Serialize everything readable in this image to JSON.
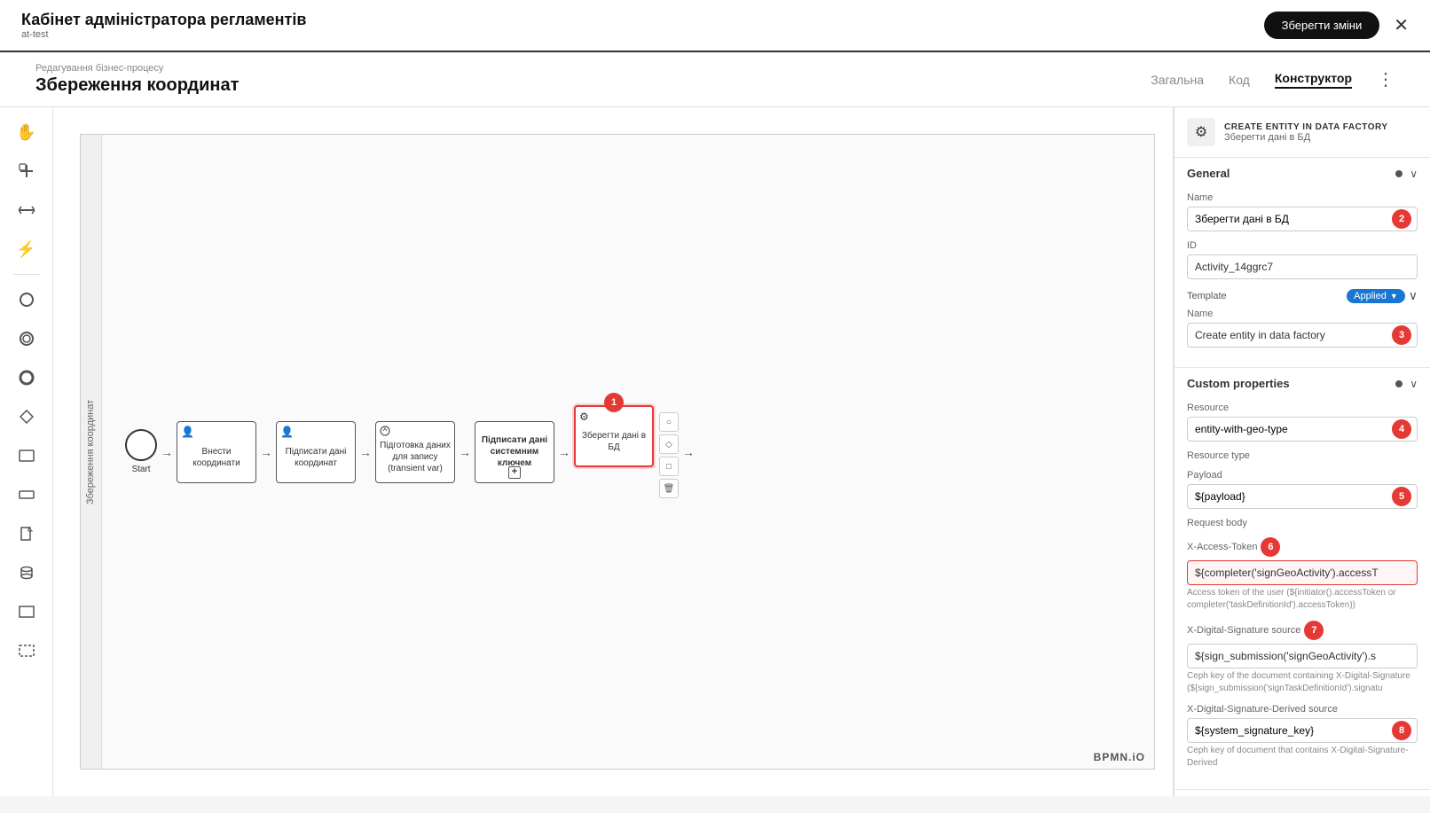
{
  "appHeader": {
    "title": "Кабінет адміністратора регламентів",
    "subtitle": "at-test",
    "saveButton": "Зберегти зміни",
    "closeIcon": "✕"
  },
  "subHeader": {
    "breadcrumb": "Редагування бізнес-процесу",
    "pageTitle": "Збереження координат",
    "navItems": [
      {
        "label": "Загальна",
        "active": false
      },
      {
        "label": "Код",
        "active": false
      },
      {
        "label": "Конструктор",
        "active": true
      }
    ],
    "moreIcon": "⋮"
  },
  "toolbar": {
    "tools": [
      {
        "name": "hand",
        "icon": "✋"
      },
      {
        "name": "cross",
        "icon": "⊕"
      },
      {
        "name": "arrows",
        "icon": "⇔"
      },
      {
        "name": "lightning",
        "icon": "⚡"
      },
      {
        "name": "circle-empty",
        "icon": "○"
      },
      {
        "name": "circle-full",
        "icon": "◯"
      },
      {
        "name": "circle-thick",
        "icon": "⬤"
      },
      {
        "name": "diamond",
        "icon": "◇"
      },
      {
        "name": "rectangle",
        "icon": "▭"
      },
      {
        "name": "rectangle-small",
        "icon": "▬"
      },
      {
        "name": "page",
        "icon": "🗋"
      },
      {
        "name": "database",
        "icon": "🗄"
      },
      {
        "name": "rectangle-outline",
        "icon": "□"
      },
      {
        "name": "dotted-rect",
        "icon": "⬚"
      }
    ]
  },
  "bpmn": {
    "processLabel": "Збереження координат",
    "nodes": [
      {
        "type": "start",
        "label": "Start"
      },
      {
        "type": "task",
        "label": "Внести координати",
        "icon": "👤"
      },
      {
        "type": "task",
        "label": "Підписати дані координат",
        "icon": "👤"
      },
      {
        "type": "task",
        "label": "Підготовка даних для запису (transient var)",
        "icon": "⚙",
        "hasPlus": false
      },
      {
        "type": "task",
        "label": "Підписати дані системним ключем",
        "hasPlus": true
      },
      {
        "type": "task",
        "label": "Зберегти дані в БД",
        "icon": "⚙",
        "selected": true
      }
    ],
    "bpmnBadge": "BPMN.iO"
  },
  "rightPanel": {
    "headerIcon": "⚙",
    "headerTitle": "CREATE ENTITY IN DATA FACTORY",
    "headerSubtitle": "Зберегти дані в БД",
    "general": {
      "sectionTitle": "General",
      "nameLabel": "Name",
      "nameValue": "Зберегти дані в БД",
      "nameBadge": "2",
      "idLabel": "ID",
      "idValue": "Activity_14ggrc7",
      "templateLabel": "Template",
      "templateApplied": "Applied",
      "templateChevron": "▼",
      "templateNameLabel": "Name",
      "templateNameValue": "Create entity in data factory",
      "templateNameBadge": "3"
    },
    "customProperties": {
      "sectionTitle": "Custom properties",
      "resourceLabel": "Resource",
      "resourceValue": "entity-with-geo-type",
      "resourceBadge": "4",
      "resourceTypeLabel": "Resource type",
      "payloadLabel": "Payload",
      "payloadValue": "${payload}",
      "payloadBadge": "5",
      "requestBodyLabel": "Request body",
      "xAccessTokenLabel": "X-Access-Token",
      "xAccessTokenBadge": "6",
      "xAccessTokenValue": "${completer('signGeoActivity').accessT",
      "xAccessTokenDesc": "Access token of the user (${initiator().accessToken or completer('taskDefinitionId').accessToken))",
      "xDigitalSignatureLabel": "X-Digital-Signature source",
      "xDigitalSignatureBadge": "7",
      "xDigitalSignatureValue": "${sign_submission('signGeoActivity').s",
      "xDigitalSignatureDesc": "Ceph key of the document containing X-Digital-Signature (${sign_submission('signTaskDefinitionId').signatu",
      "xDigitalSignatureDerivedLabel": "X-Digital-Signature-Derived source",
      "xDigitalSignatureDerivedValue": "${system_signature_key}",
      "xDigitalSignatureDerivedBadge": "8",
      "xDigitalSignatureDerivedDesc": "Ceph key of document that contains X-Digital-Signature-Derived"
    }
  }
}
